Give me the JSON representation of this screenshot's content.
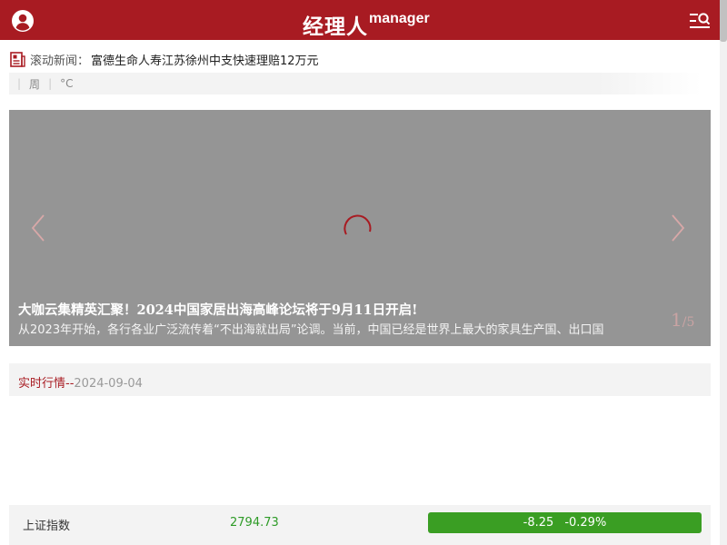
{
  "header": {
    "logo_cn": "经理人",
    "logo_en": "manager",
    "bg_color": "#a81b22"
  },
  "icons": {
    "user": "user-circle-icon",
    "menu_search": "menu-search-icon",
    "news": "news-icon",
    "prev": "chevron-left-icon",
    "next": "chevron-right-icon",
    "loading": "spinner-icon"
  },
  "ticker": {
    "label": "滚动新闻：",
    "text": "富德生命人寿江苏徐州中支快速理赔12万元"
  },
  "weather": {
    "day": "周",
    "temp_unit": "°C"
  },
  "slider": {
    "title": "大咖云集精英汇聚！2024中国家居出海高峰论坛将于9月11日开启!",
    "desc": "从2023年开始，各行各业广泛流传着“不出海就出局”论调。当前，中国已经是世界上最大的家具生产国、出口国",
    "current": "1",
    "total": "/5"
  },
  "market": {
    "title": "实时行情",
    "sep": "--",
    "date": "2024-09-04",
    "rows": [
      {
        "name": "上证指数",
        "value": "2794.73",
        "change": "-8.25",
        "percent": "-0.29%"
      }
    ],
    "up_color": "#3a9e23"
  }
}
